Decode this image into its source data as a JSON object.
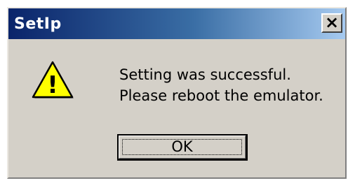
{
  "window": {
    "title": "SetIp",
    "close_label": "×"
  },
  "icon": {
    "name": "warning-icon",
    "glyph": "!",
    "fill_color": "#ffff00",
    "stroke_color": "#000000"
  },
  "message": {
    "line1": "Setting was successful.",
    "line2": "Please reboot the emulator."
  },
  "buttons": {
    "ok_label": "OK"
  },
  "colors": {
    "title_start": "#0a246a",
    "title_end": "#a6caf0",
    "dialog_bg": "#d4d0c8"
  }
}
